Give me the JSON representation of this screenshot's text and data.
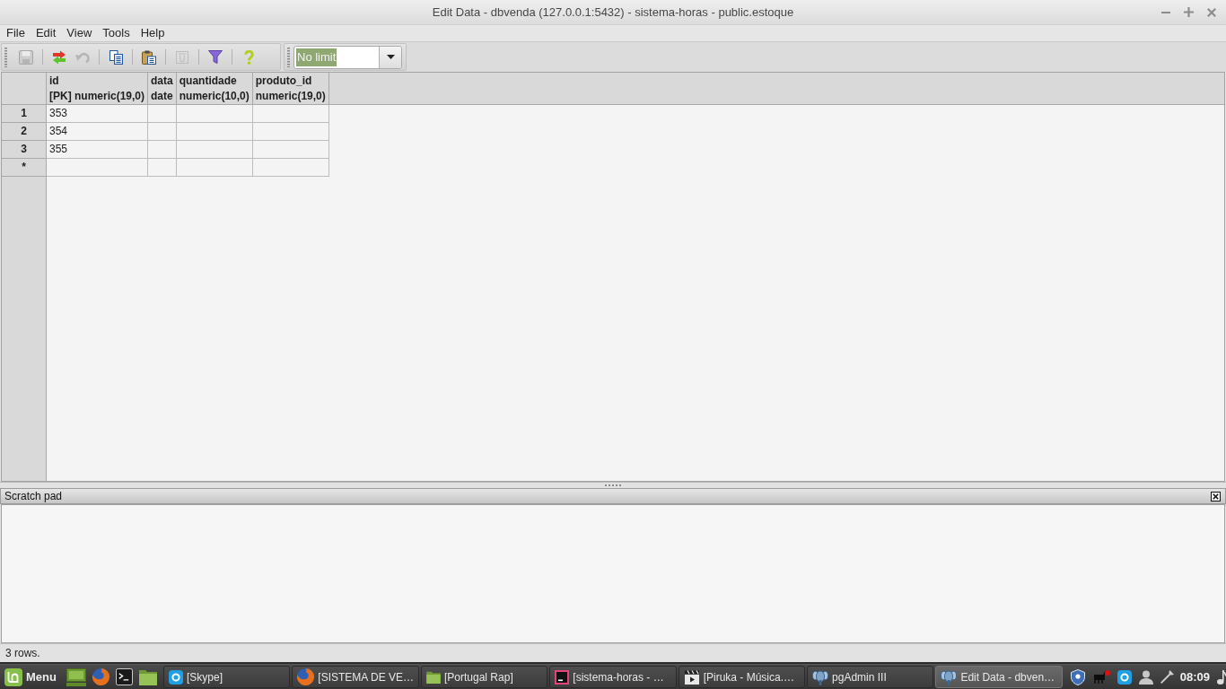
{
  "window": {
    "title": "Edit Data - dbvenda (127.0.0.1:5432) - sistema-horas - public.estoque"
  },
  "menu": [
    {
      "label": "File"
    },
    {
      "label": "Edit"
    },
    {
      "label": "View"
    },
    {
      "label": "Tools"
    },
    {
      "label": "Help"
    }
  ],
  "toolbar": {
    "groups": [
      [
        {
          "kind": "save",
          "disabled": true
        }
      ],
      [
        {
          "kind": "refresh",
          "disabled": false
        },
        {
          "kind": "undo",
          "disabled": true
        }
      ],
      [
        {
          "kind": "copy",
          "disabled": false
        }
      ],
      [
        {
          "kind": "paste",
          "disabled": false
        }
      ],
      [
        {
          "kind": "delete",
          "disabled": true
        }
      ],
      [
        {
          "kind": "filter",
          "disabled": false
        }
      ],
      [
        {
          "kind": "help",
          "disabled": false
        }
      ]
    ]
  },
  "row_limit": {
    "value": "No limit",
    "text_selected": true
  },
  "grid": {
    "columns": [
      {
        "name": "id",
        "type": "[PK] numeric(19,0)"
      },
      {
        "name": "data",
        "type": "date"
      },
      {
        "name": "quantidade",
        "type": "numeric(10,0)"
      },
      {
        "name": "produto_id",
        "type": "numeric(19,0)"
      }
    ],
    "rows": [
      {
        "header": "1",
        "cells": [
          "353"
        ]
      },
      {
        "header": "2",
        "cells": [
          "354"
        ]
      },
      {
        "header": "3",
        "cells": [
          "355"
        ]
      }
    ],
    "new_row": {
      "header": "*"
    }
  },
  "scratch_pad": {
    "title": "Scratch pad"
  },
  "status_bar": {
    "text": "3 rows."
  },
  "taskbar": {
    "menu": {
      "label": "Menu"
    },
    "launchers": [
      {
        "kind": "desktop"
      },
      {
        "kind": "browser"
      },
      {
        "kind": "terminal"
      },
      {
        "kind": "files"
      }
    ],
    "windows": [
      {
        "kind": "chat",
        "label": "[Skype]",
        "selected": false
      },
      {
        "kind": "browser",
        "label": "[SISTEMA DE VE…",
        "selected": false
      },
      {
        "kind": "folder",
        "label": "[Portugal Rap]",
        "selected": false
      },
      {
        "kind": "ide",
        "label": "[sistema-horas - …",
        "selected": false
      },
      {
        "kind": "video",
        "label": "[Piruka - Música.…",
        "selected": false
      },
      {
        "kind": "pgadmin",
        "label": "pgAdmin III",
        "selected": false
      },
      {
        "kind": "pgadmin",
        "label": "Edit Data - dbven…",
        "selected": true
      }
    ],
    "tray": [
      {
        "kind": "shield"
      },
      {
        "kind": "monitor"
      },
      {
        "kind": "chat"
      },
      {
        "kind": "user"
      },
      {
        "kind": "network"
      },
      {
        "kind": "clock",
        "text": "08:09"
      },
      {
        "kind": "sound"
      }
    ]
  }
}
